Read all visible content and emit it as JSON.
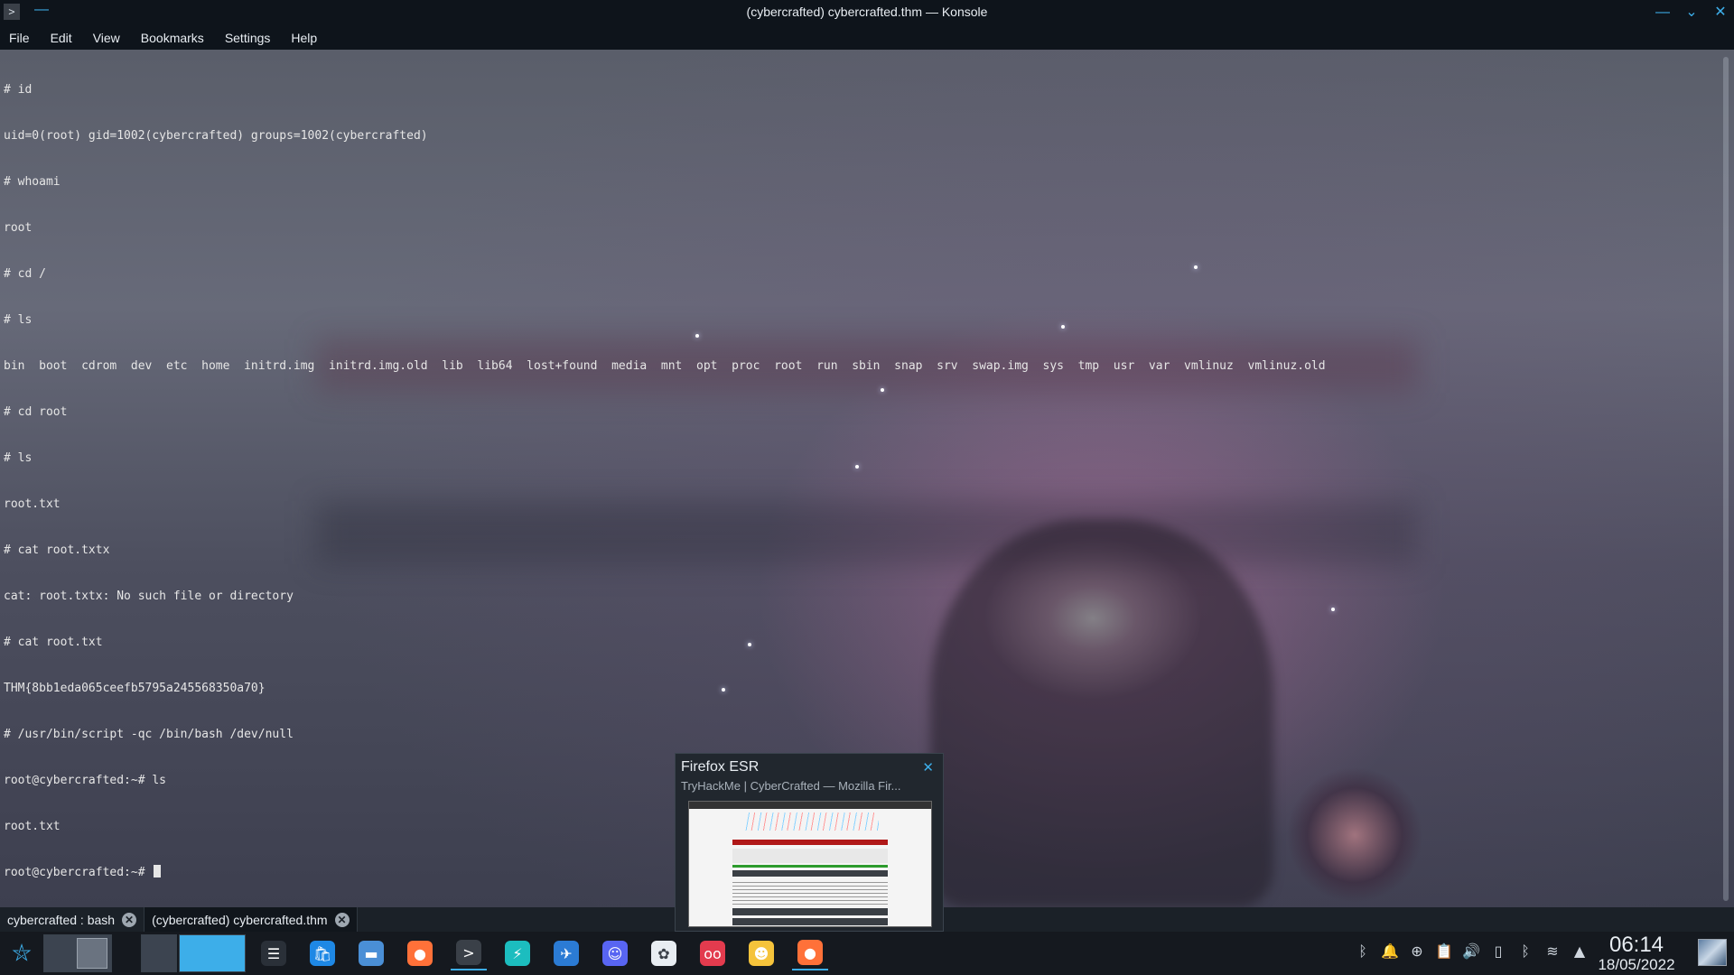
{
  "window": {
    "title": "(cybercrafted) cybercrafted.thm — Konsole"
  },
  "menu": [
    "File",
    "Edit",
    "View",
    "Bookmarks",
    "Settings",
    "Help"
  ],
  "terminal": {
    "lines": [
      "# id",
      "uid=0(root) gid=1002(cybercrafted) groups=1002(cybercrafted)",
      "# whoami",
      "root",
      "# cd /",
      "# ls",
      "bin  boot  cdrom  dev  etc  home  initrd.img  initrd.img.old  lib  lib64  lost+found  media  mnt  opt  proc  root  run  sbin  snap  srv  swap.img  sys  tmp  usr  var  vmlinuz  vmlinuz.old",
      "# cd root",
      "# ls",
      "root.txt",
      "# cat root.txtx",
      "cat: root.txtx: No such file or directory",
      "# cat root.txt",
      "THM{8bb1eda065ceefb5795a245568350a70}",
      "# /usr/bin/script -qc /bin/bash /dev/null",
      "root@cybercrafted:~# ls",
      "root.txt"
    ],
    "prompt": "root@cybercrafted:~# "
  },
  "tabs": [
    {
      "label": "cybercrafted : bash",
      "close": "✕"
    },
    {
      "label": "(cybercrafted) cybercrafted.thm",
      "close": "✕"
    }
  ],
  "tooltip": {
    "title": "Firefox ESR",
    "subtitle": "TryHackMe | CyberCrafted — Mozilla Fir...",
    "close": "✕"
  },
  "taskbar": {
    "launcher_icon": "kde-launcher-icon",
    "apps": [
      {
        "name": "system-settings",
        "glyph": "☰",
        "color": "#2a3038"
      },
      {
        "name": "discover-store",
        "glyph": "🛍",
        "color": "#1e88e5"
      },
      {
        "name": "file-manager",
        "glyph": "▬",
        "color": "#4a8fd6"
      },
      {
        "name": "firefox",
        "glyph": "●",
        "color": "#ff7139"
      },
      {
        "name": "konsole",
        "glyph": ">",
        "color": "#3a4048"
      },
      {
        "name": "electron-app",
        "glyph": "⚡",
        "color": "#1cbdbf"
      },
      {
        "name": "browser-2",
        "glyph": "✈",
        "color": "#2b7bd4"
      },
      {
        "name": "discord",
        "glyph": "☺",
        "color": "#5865f2"
      },
      {
        "name": "app-white",
        "glyph": "✿",
        "color": "#e8edf2"
      },
      {
        "name": "app-red",
        "glyph": "oo",
        "color": "#e33b4e"
      },
      {
        "name": "emoji-picker",
        "glyph": "☻",
        "color": "#f5c33b"
      },
      {
        "name": "firefox-esr",
        "glyph": "●",
        "color": "#ff7139"
      }
    ]
  },
  "tray": {
    "icons": [
      "bluetooth-icon",
      "notifications-icon",
      "updates-icon",
      "clipboard-icon",
      "volume-icon",
      "battery-icon",
      "bluetooth-2-icon",
      "wifi-icon",
      "expand-tray-icon"
    ],
    "glyphs": [
      "ᛒ",
      "🔔",
      "⊕",
      "📋",
      "🔊",
      "▯",
      "ᛒ",
      "≋",
      "▲"
    ]
  },
  "clock": {
    "time": "06:14",
    "date": "18/05/2022"
  }
}
